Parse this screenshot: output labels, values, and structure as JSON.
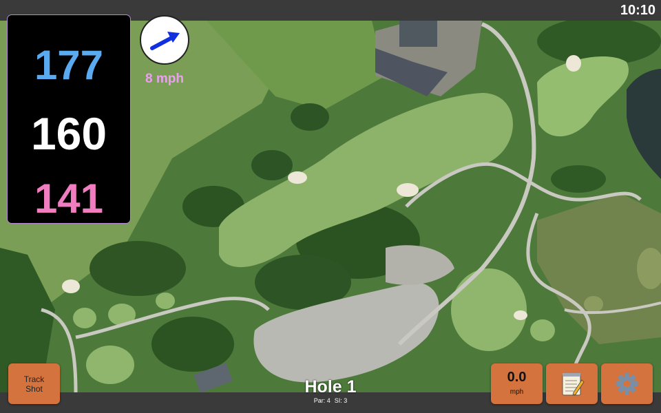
{
  "status_bar": {
    "time": "10:10"
  },
  "yardages": {
    "back": "177",
    "middle": "160",
    "front": "141",
    "back_color": "#5aaaf0",
    "middle_color": "#ffffff",
    "front_color": "#f07dc0"
  },
  "wind": {
    "speed_label": "8 mph",
    "arrow_color": "#1030e0",
    "speed_color": "#e9a0ef"
  },
  "hole": {
    "title": "Hole 1",
    "par": "Par: 4",
    "si": "SI: 3"
  },
  "buttons": {
    "track_line1": "Track",
    "track_line2": "Shot",
    "speed_value": "0.0",
    "speed_unit": "mph",
    "notes_icon": "notepad-icon",
    "settings_icon": "gear-icon"
  },
  "colors": {
    "button_bg": "#d4733d",
    "map_base": "#4f7a3a"
  }
}
